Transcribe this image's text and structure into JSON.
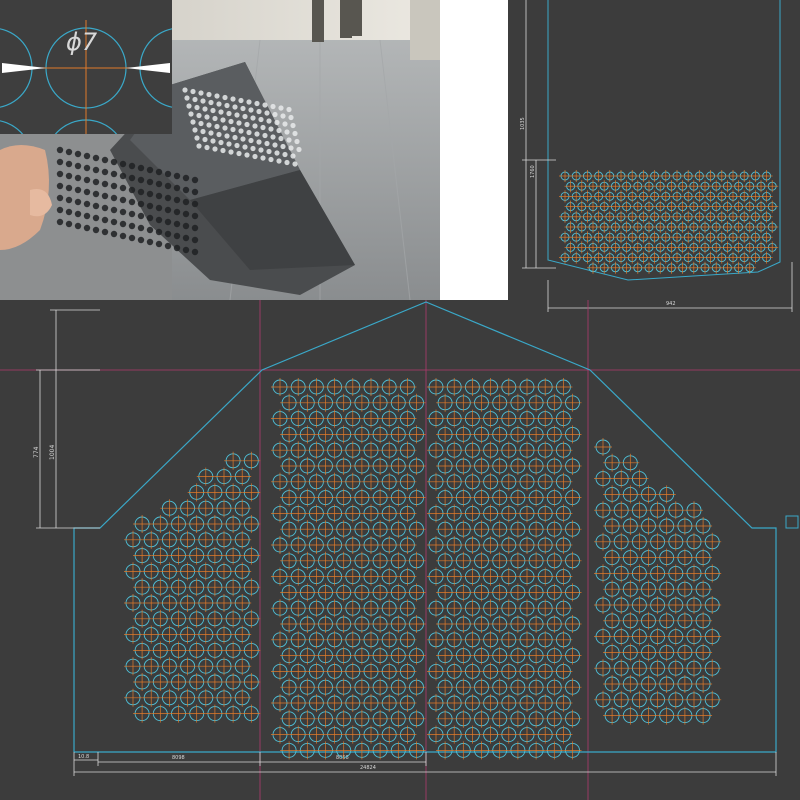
{
  "inset": {
    "diameter_label": "ϕ7"
  },
  "top_drawing": {
    "dim_height_total": "1035",
    "dim_height_part": "1760",
    "dim_width": "942"
  },
  "main_drawing": {
    "dim_vertical_outer": "1004",
    "dim_vertical_inner": "774",
    "dim_bottom_small": "10.8",
    "dim_bottom_left": "8098",
    "dim_bottom_mid": "8056",
    "dim_bottom_total": "24824"
  },
  "colors": {
    "background": "#3c3c3c",
    "outline": "#3aa8c8",
    "hole": "#4ec0d8",
    "center_mark": "#e07a2a",
    "guide": "#b03a6e",
    "dimension": "#d8d8d8"
  }
}
